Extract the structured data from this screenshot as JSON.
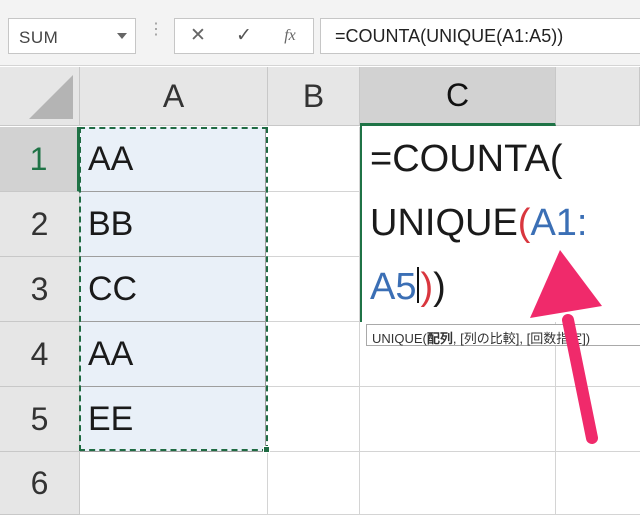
{
  "formula_bar": {
    "name_box": "SUM",
    "cancel_glyph": "✕",
    "enter_glyph": "✓",
    "fx_glyph": "fx",
    "formula": "=COUNTA(UNIQUE(A1:A5))"
  },
  "columns": [
    "A",
    "B",
    "C"
  ],
  "rows": [
    "1",
    "2",
    "3",
    "4",
    "5",
    "6"
  ],
  "cells_a": [
    "AA",
    "BB",
    "CC",
    "AA",
    "EE"
  ],
  "editor": {
    "line1": "=COUNTA(",
    "line2_func": "UNIQUE",
    "line2_paren": "(",
    "line2_ref": "A1:",
    "line3_ref": "A5",
    "line3_red_paren": ")",
    "line3_paren": ")"
  },
  "tooltip": {
    "func": "UNIQUE(",
    "arg1": "配列",
    "rest": ", [列の比較], [回数指定])"
  },
  "colors": {
    "accent_green": "#1f7346",
    "ref_blue": "#3b6fb5",
    "ref_red": "#d9363e",
    "arrow_pink": "#f02a6b"
  }
}
